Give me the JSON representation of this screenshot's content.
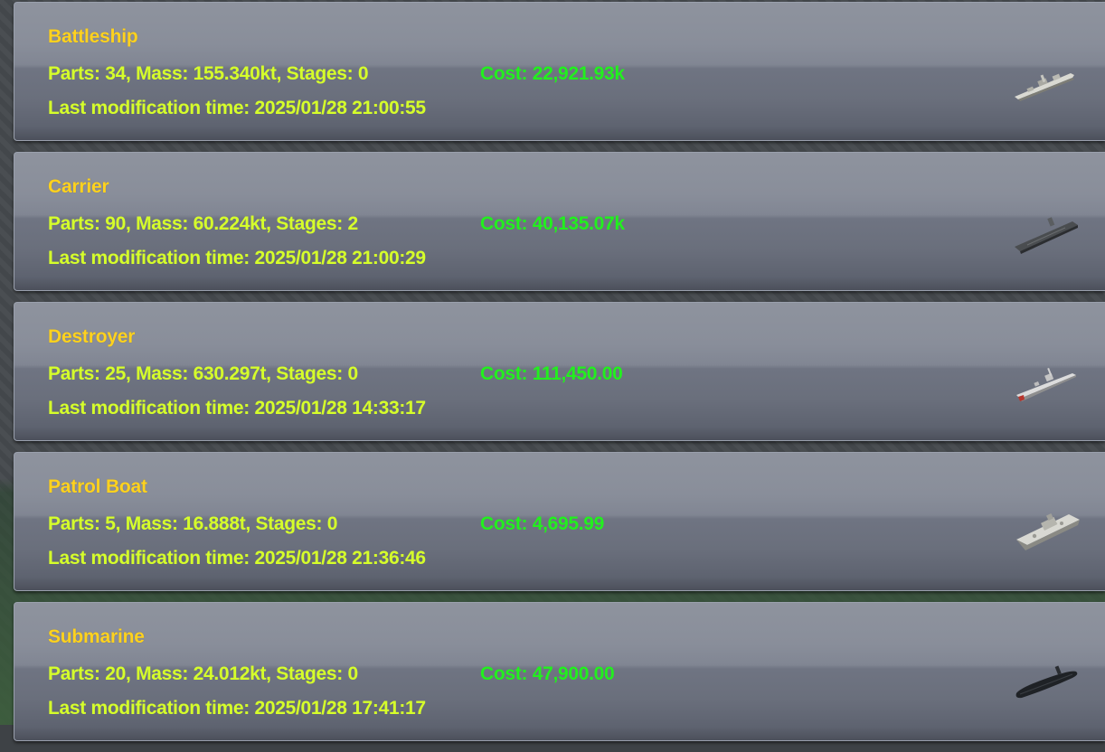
{
  "craft_list": [
    {
      "name": "Battleship",
      "stats": "Parts: 34, Mass: 155.340kt, Stages: 0",
      "cost": "Cost: 22,921.93k",
      "modified": "Last modification time: 2025/01/28 21:00:55",
      "thumbnail_icon": "battleship-icon"
    },
    {
      "name": "Carrier",
      "stats": "Parts: 90, Mass: 60.224kt, Stages: 2",
      "cost": "Cost: 40,135.07k",
      "modified": "Last modification time: 2025/01/28 21:00:29",
      "thumbnail_icon": "carrier-icon"
    },
    {
      "name": "Destroyer",
      "stats": "Parts: 25, Mass: 630.297t, Stages: 0",
      "cost": "Cost: 111,450.00",
      "modified": "Last modification time: 2025/01/28 14:33:17",
      "thumbnail_icon": "destroyer-icon"
    },
    {
      "name": "Patrol Boat",
      "stats": "Parts: 5, Mass: 16.888t, Stages: 0",
      "cost": "Cost: 4,695.99",
      "modified": "Last modification time: 2025/01/28 21:36:46",
      "thumbnail_icon": "patrol-boat-icon"
    },
    {
      "name": "Submarine",
      "stats": "Parts: 20, Mass: 24.012kt, Stages: 0",
      "cost": "Cost: 47,900.00",
      "modified": "Last modification time: 2025/01/28 17:41:17",
      "thumbnail_icon": "submarine-icon"
    }
  ],
  "colors": {
    "title": "#ffd21e",
    "info": "#d6ff2a",
    "cost": "#22f01e",
    "card": "#7d8290"
  }
}
